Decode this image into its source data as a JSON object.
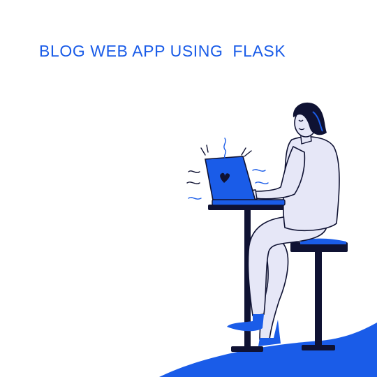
{
  "title": "BLOG WEB APP USING  FLASK",
  "colors": {
    "accent": "#1a5ce8",
    "figure_fill": "#e6e7f7",
    "outline": "#0f1233",
    "background": "#ffffff"
  },
  "icons": {
    "laptop": "laptop-icon",
    "heart": "heart-icon"
  }
}
